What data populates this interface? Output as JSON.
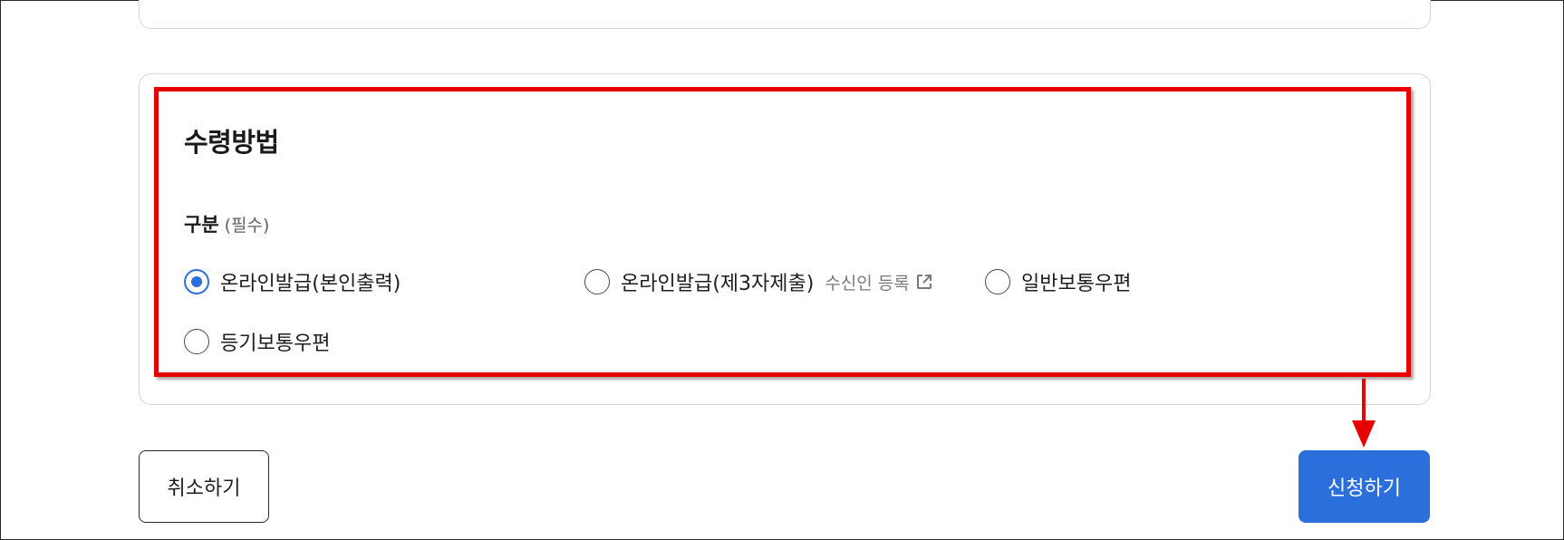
{
  "section": {
    "title": "수령방법",
    "field_label": "구분",
    "field_required": "(필수)"
  },
  "options": [
    {
      "label": "온라인발급(본인출력)",
      "checked": true
    },
    {
      "label": "온라인발급(제3자제출)",
      "checked": false,
      "link": "수신인 등록"
    },
    {
      "label": "일반보통우편",
      "checked": false
    },
    {
      "label": "등기보통우편",
      "checked": false
    }
  ],
  "buttons": {
    "cancel": "취소하기",
    "submit": "신청하기"
  },
  "colors": {
    "accent": "#2a6fdb",
    "highlight": "#e60000"
  },
  "icons": {
    "external_link": "external-link-icon",
    "arrow": "arrow-down-icon"
  }
}
